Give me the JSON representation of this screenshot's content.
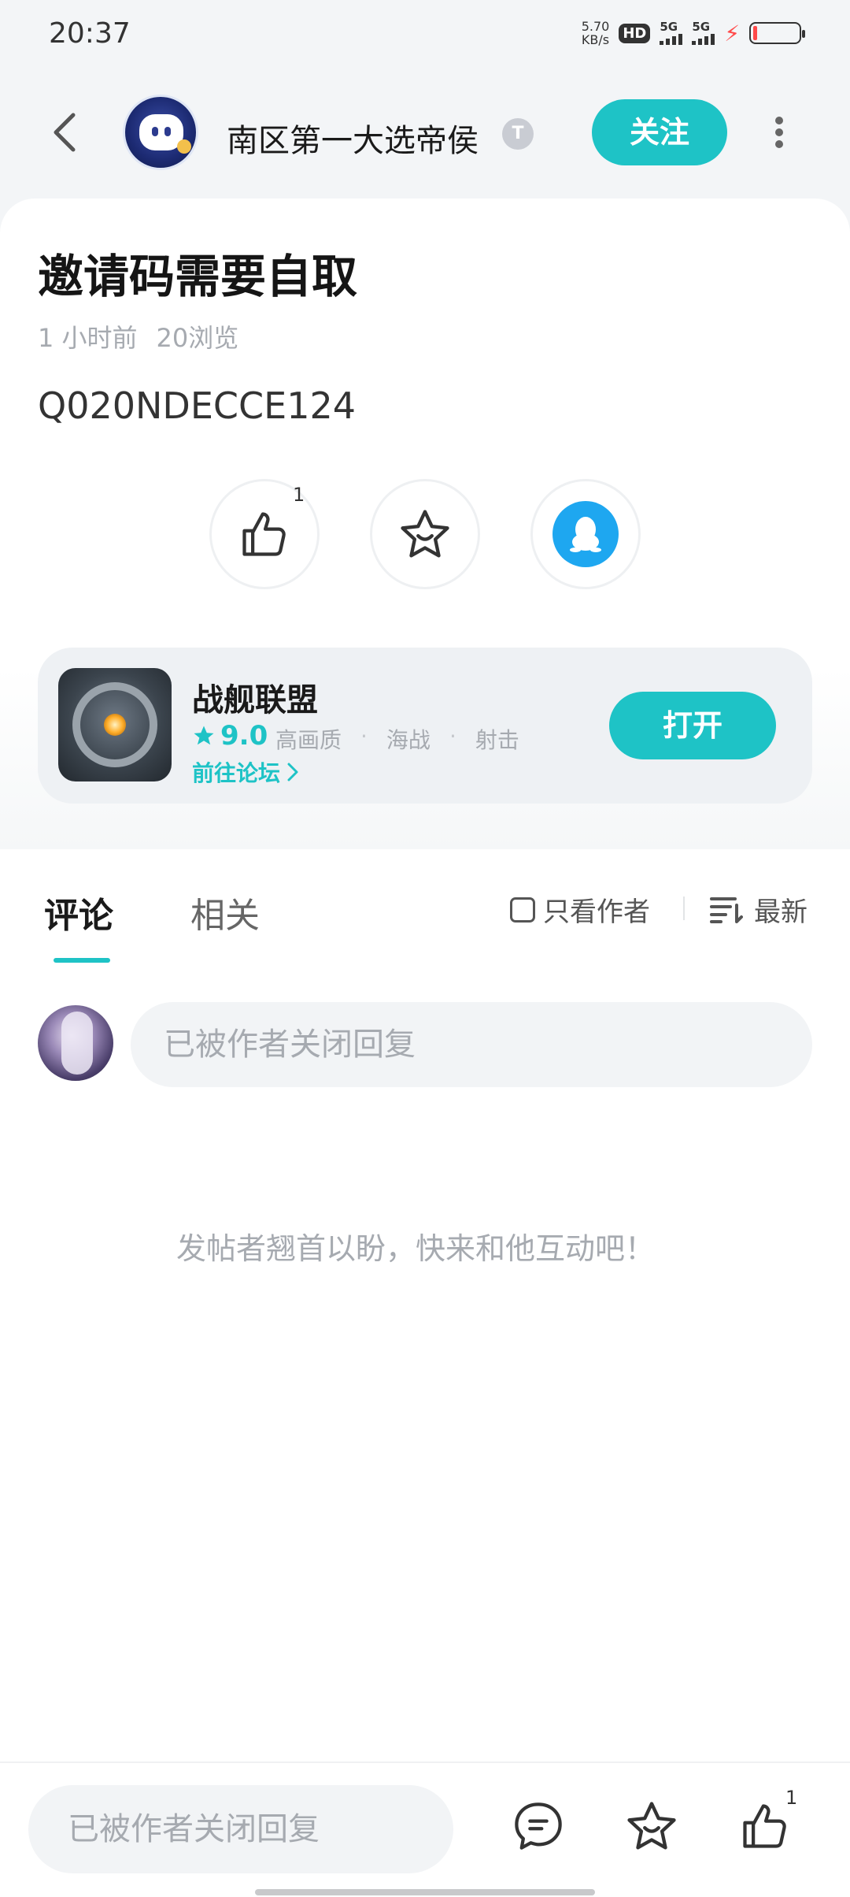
{
  "status_bar": {
    "time": "20:37",
    "speed_value": "5.70",
    "speed_unit": "KB/s",
    "hd_badge": "HD",
    "signal_1": "5G",
    "signal_2": "5G"
  },
  "header": {
    "author_name": "南区第一大选帝侯",
    "verified_badge": "T",
    "follow_label": "关注"
  },
  "post": {
    "title": "邀请码需要自取",
    "time_ago": "1 小时前",
    "views": "20浏览",
    "body": "Q020NDECCE124",
    "like_count": "1"
  },
  "game": {
    "name": "战舰联盟",
    "rating": "9.0",
    "tags": [
      "高画质",
      "海战",
      "射击"
    ],
    "forum_link": "前往论坛",
    "open_label": "打开"
  },
  "comments": {
    "tab_comments": "评论",
    "tab_related": "相关",
    "author_only_label": "只看作者",
    "sort_label": "最新",
    "reply_placeholder": "已被作者关闭回复",
    "empty_hint": "发帖者翘首以盼，快来和他互动吧！"
  },
  "bottom_bar": {
    "input_placeholder": "已被作者关闭回复",
    "like_count": "1"
  },
  "colors": {
    "accent": "#1ec3c6",
    "qq_blue": "#1ea7f0",
    "muted_text": "#a6aab0"
  }
}
